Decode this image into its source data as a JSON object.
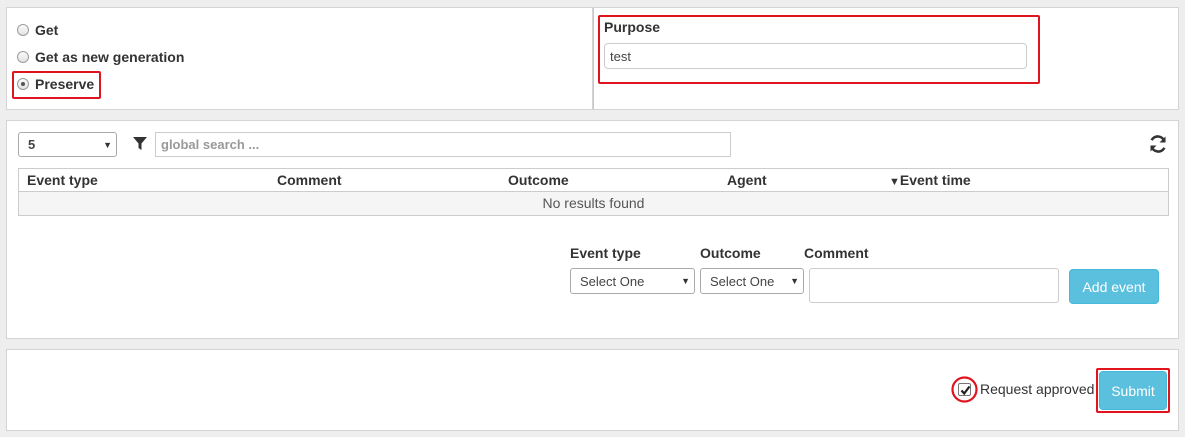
{
  "retrieval": {
    "options": [
      {
        "label": "Get",
        "checked": false
      },
      {
        "label": "Get as new generation",
        "checked": false
      },
      {
        "label": "Preserve",
        "checked": true
      }
    ]
  },
  "purpose": {
    "label": "Purpose",
    "value": "test"
  },
  "table_controls": {
    "page_size": "5",
    "search_placeholder": "global search ..."
  },
  "events_table": {
    "columns": [
      "Event type",
      "Comment",
      "Outcome",
      "Agent",
      "Event time"
    ],
    "sort_column": "Event time",
    "sort_indicator": "▼",
    "empty_text": "No results found"
  },
  "add_event_form": {
    "event_type_label": "Event type",
    "event_type_value": "Select One",
    "outcome_label": "Outcome",
    "outcome_value": "Select One",
    "comment_label": "Comment",
    "add_button": "Add event"
  },
  "footer": {
    "approved_label": "Request approved",
    "approved_checked": true,
    "submit_label": "Submit"
  },
  "colors": {
    "highlight": "#e0141e",
    "button_info": "#5bc0de"
  },
  "icons": [
    "filter-icon",
    "refresh-icon",
    "caret-down-icon",
    "sort-desc-icon",
    "checkmark-icon"
  ]
}
